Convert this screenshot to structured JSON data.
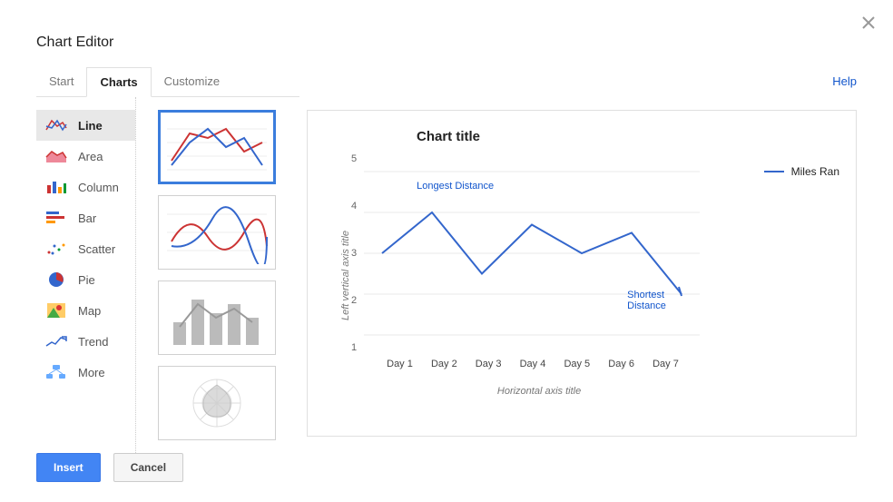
{
  "title": "Chart Editor",
  "help": "Help",
  "tabs": {
    "start": "Start",
    "charts": "Charts",
    "customize": "Customize"
  },
  "sidebar": {
    "line": "Line",
    "area": "Area",
    "column": "Column",
    "bar": "Bar",
    "scatter": "Scatter",
    "pie": "Pie",
    "map": "Map",
    "trend": "Trend",
    "more": "More"
  },
  "chart_data": {
    "type": "line",
    "title": "Chart title",
    "xlabel": "Horizontal axis title",
    "ylabel": "Left vertical axis title",
    "categories": [
      "Day 1",
      "Day 2",
      "Day 3",
      "Day 4",
      "Day 5",
      "Day 6",
      "Day 7"
    ],
    "series": [
      {
        "name": "Miles Ran",
        "values": [
          3.0,
          4.0,
          2.5,
          3.7,
          3.0,
          3.5,
          2.0
        ]
      }
    ],
    "y_ticks": [
      5,
      4,
      3,
      2,
      1
    ],
    "ylim": [
      1,
      5
    ],
    "annotations": [
      {
        "label": "Longest Distance",
        "x": "Day 2",
        "y": 4.0
      },
      {
        "label": "Shortest Distance",
        "x": "Day 7",
        "y": 2.0
      }
    ]
  },
  "buttons": {
    "insert": "Insert",
    "cancel": "Cancel"
  }
}
